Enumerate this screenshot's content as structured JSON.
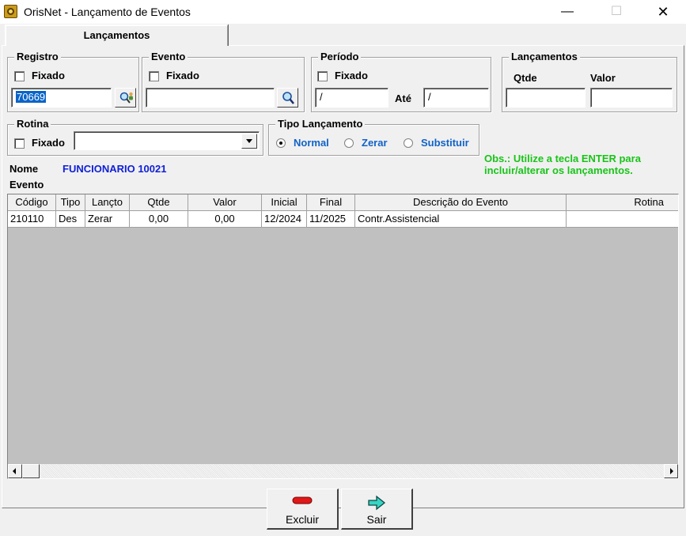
{
  "window": {
    "title": "OrisNet - Lançamento de Eventos",
    "minimize": "—",
    "maximize": "☐",
    "close": "✕"
  },
  "tab": {
    "label": "Lançamentos"
  },
  "registro": {
    "legend": "Registro",
    "fixado_label": "Fixado",
    "fixado_checked": false,
    "value": "70669"
  },
  "evento": {
    "legend": "Evento",
    "fixado_label": "Fixado",
    "fixado_checked": false,
    "value": ""
  },
  "periodo": {
    "legend": "Período",
    "fixado_label": "Fixado",
    "fixado_checked": false,
    "de_value": "/",
    "ate_label": "Até",
    "ate_value": "/"
  },
  "lancamentos_totais": {
    "legend": "Lançamentos",
    "qtde_label": "Qtde",
    "valor_label": "Valor",
    "qtde_value": "",
    "valor_value": ""
  },
  "rotina": {
    "legend": "Rotina",
    "fixado_label": "Fixado",
    "fixado_checked": false,
    "selected": ""
  },
  "tipo_lancamento": {
    "legend": "Tipo Lançamento",
    "options": [
      "Normal",
      "Zerar",
      "Substituir"
    ],
    "selected": "Normal"
  },
  "obs": {
    "line1": "Obs.: Utilize a tecla ENTER para",
    "line2": "incluir/alterar os lançamentos."
  },
  "info": {
    "nome_label": "Nome",
    "nome_value": "FUNCIONARIO 10021",
    "evento_label": "Evento"
  },
  "grid": {
    "columns": [
      "Código",
      "Tipo",
      "Lançto",
      "Qtde",
      "Valor",
      "Inicial",
      "Final",
      "Descrição do Evento",
      "Rotina"
    ],
    "rows": [
      [
        "210110",
        "Des",
        "Zerar",
        "0,00",
        "0,00",
        "12/2024",
        "11/2025",
        "Contr.Assistencial",
        ""
      ]
    ]
  },
  "buttons": {
    "excluir": "Excluir",
    "sair": "Sair"
  },
  "colors": {
    "accent_blue": "#1062c8",
    "name_blue": "#1020d8",
    "obs_green": "#18c418",
    "selection": "#0a64c8"
  }
}
